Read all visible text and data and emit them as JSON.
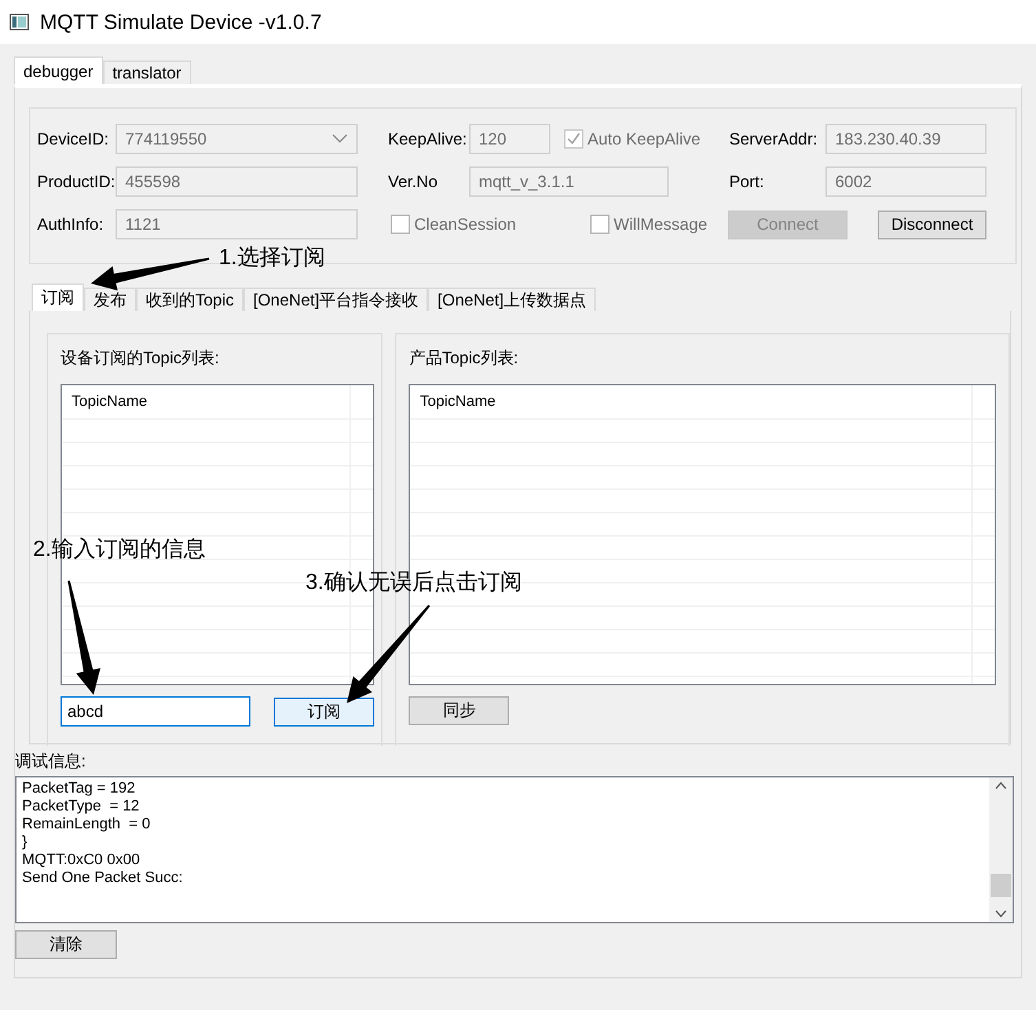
{
  "window": {
    "title": "MQTT Simulate Device  -v1.0.7"
  },
  "top_tabs": [
    {
      "label": "debugger",
      "selected": true
    },
    {
      "label": "translator",
      "selected": false
    }
  ],
  "connection": {
    "columns": [
      [
        {
          "kind": "combo",
          "label": "DeviceID:",
          "value": "774119550"
        },
        {
          "kind": "text",
          "label": "ProductID:",
          "value": "455598"
        },
        {
          "kind": "text",
          "label": "AuthInfo:",
          "value": "1121"
        }
      ],
      [
        {
          "kind": "text-check",
          "label": "KeepAlive:",
          "value": "120",
          "check": {
            "label": "Auto KeepAlive",
            "checked": true,
            "disabled": true
          }
        },
        {
          "kind": "text",
          "label": "Ver.No",
          "value": "mqtt_v_3.1.1"
        },
        {
          "kind": "checks",
          "checks": [
            {
              "label": "CleanSession",
              "checked": false,
              "disabled": false
            },
            {
              "label": "WillMessage",
              "checked": false,
              "disabled": false
            }
          ]
        }
      ],
      [
        {
          "kind": "text",
          "label": "ServerAddr:",
          "value": "183.230.40.39"
        },
        {
          "kind": "text",
          "label": "Port:",
          "value": "6002"
        },
        {
          "kind": "buttons",
          "buttons": [
            {
              "label": "Connect",
              "disabled": true
            },
            {
              "label": "Disconnect",
              "disabled": false
            }
          ]
        }
      ]
    ]
  },
  "sub_tabs": [
    {
      "label": "订阅",
      "selected": true
    },
    {
      "label": "发布",
      "selected": false
    },
    {
      "label": "收到的Topic",
      "selected": false
    },
    {
      "label": "[OneNet]平台指令接收",
      "selected": false
    },
    {
      "label": "[OneNet]上传数据点",
      "selected": false
    }
  ],
  "device_topics": {
    "title": "设备订阅的Topic列表:",
    "column": "TopicName",
    "input": "abcd",
    "button": "订阅"
  },
  "product_topics": {
    "title": "产品Topic列表:",
    "column": "TopicName",
    "button": "同步"
  },
  "debug": {
    "title": "调试信息:",
    "lines": [
      "PacketTag = 192",
      "PacketType  = 12",
      "RemainLength  = 0",
      "}",
      "MQTT:0xC0 0x00",
      "Send One Packet Succ:"
    ],
    "button": "清除"
  },
  "annotations": [
    {
      "text": "1.选择订阅"
    },
    {
      "text": "2.输入订阅的信息"
    },
    {
      "text": "3.确认无误后点击订阅"
    }
  ]
}
